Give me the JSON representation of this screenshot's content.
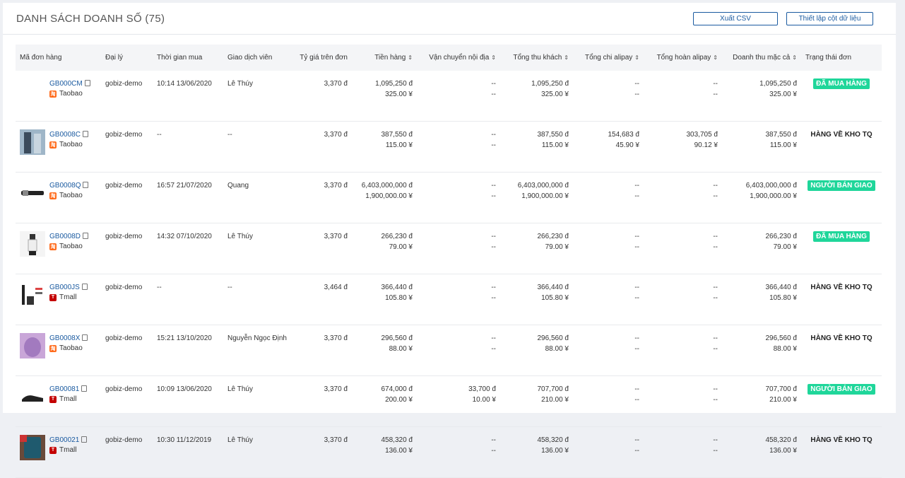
{
  "header": {
    "title": "DANH SÁCH DOANH SỐ (75)",
    "export_csv": "Xuất CSV",
    "column_settings": "Thiết lập cột dữ liệu"
  },
  "columns": [
    {
      "label": "Mã đơn hàng",
      "sortable": false
    },
    {
      "label": "Đại lý",
      "sortable": false
    },
    {
      "label": "Thời gian mua",
      "sortable": false
    },
    {
      "label": "Giao dịch viên",
      "sortable": false
    },
    {
      "label": "Tỷ giá trên đơn",
      "sortable": false
    },
    {
      "label": "Tiền hàng",
      "sortable": true
    },
    {
      "label": "Vận chuyển nội địa",
      "sortable": true
    },
    {
      "label": "Tổng thu khách",
      "sortable": true
    },
    {
      "label": "Tổng chi alipay",
      "sortable": true
    },
    {
      "label": "Tổng hoàn alipay",
      "sortable": true
    },
    {
      "label": "Doanh thu mặc cả",
      "sortable": true
    },
    {
      "label": "Trạng thái đơn",
      "sortable": false
    }
  ],
  "status_colors": {
    "badge": "#1fd69a",
    "link": "#1a5aa0"
  },
  "rows": [
    {
      "code": "GB000CM",
      "platform": "Taobao",
      "thumb": "none",
      "agency": "gobiz-demo",
      "time": "10:14 13/06/2020",
      "staff": "Lê Thúy",
      "rate": "3,370 đ",
      "goods_vnd": "1,095,250 đ",
      "goods_cny": "325.00 ¥",
      "ship_vnd": "--",
      "ship_cny": "--",
      "total_vnd": "1,095,250 đ",
      "total_cny": "325.00 ¥",
      "alipay_out": "--",
      "alipay_out2": "--",
      "alipay_ref": "--",
      "alipay_ref2": "--",
      "rev_vnd": "1,095,250 đ",
      "rev_cny": "325.00 ¥",
      "status": "ĐÃ MUA HÀNG",
      "status_badge": true
    },
    {
      "code": "GB0008C",
      "platform": "Taobao",
      "thumb": "clothes-photo",
      "agency": "gobiz-demo",
      "time": "--",
      "staff": "--",
      "rate": "3,370 đ",
      "goods_vnd": "387,550 đ",
      "goods_cny": "115.00 ¥",
      "ship_vnd": "--",
      "ship_cny": "--",
      "total_vnd": "387,550 đ",
      "total_cny": "115.00 ¥",
      "alipay_out": "154,683 đ",
      "alipay_out2": "45.90 ¥",
      "alipay_ref": "303,705 đ",
      "alipay_ref2": "90.12 ¥",
      "rev_vnd": "387,550 đ",
      "rev_cny": "115.00 ¥",
      "status": "HÀNG VỀ KHO TQ",
      "status_badge": false
    },
    {
      "code": "GB0008Q",
      "platform": "Taobao",
      "thumb": "belt-photo",
      "agency": "gobiz-demo",
      "time": "16:57 21/07/2020",
      "staff": "Quang",
      "rate": "3,370 đ",
      "goods_vnd": "6,403,000,000 đ",
      "goods_cny": "1,900,000.00 ¥",
      "ship_vnd": "--",
      "ship_cny": "--",
      "total_vnd": "6,403,000,000 đ",
      "total_cny": "1,900,000.00 ¥",
      "alipay_out": "--",
      "alipay_out2": "--",
      "alipay_ref": "--",
      "alipay_ref2": "--",
      "rev_vnd": "6,403,000,000 đ",
      "rev_cny": "1,900,000.00 ¥",
      "status": "NGƯỜI BÁN GIAO",
      "status_badge": true
    },
    {
      "code": "GB0008D",
      "platform": "Taobao",
      "thumb": "outfit-photo",
      "agency": "gobiz-demo",
      "time": "14:32 07/10/2020",
      "staff": "Lê Thúy",
      "rate": "3,370 đ",
      "goods_vnd": "266,230 đ",
      "goods_cny": "79.00 ¥",
      "ship_vnd": "--",
      "ship_cny": "--",
      "total_vnd": "266,230 đ",
      "total_cny": "79.00 ¥",
      "alipay_out": "--",
      "alipay_out2": "--",
      "alipay_ref": "--",
      "alipay_ref2": "--",
      "rev_vnd": "266,230 đ",
      "rev_cny": "79.00 ¥",
      "status": "ĐÃ MUA HÀNG",
      "status_badge": true
    },
    {
      "code": "GB000JS",
      "platform": "Tmall",
      "thumb": "product-photo",
      "agency": "gobiz-demo",
      "time": "--",
      "staff": "--",
      "rate": "3,464 đ",
      "goods_vnd": "366,440 đ",
      "goods_cny": "105.80 ¥",
      "ship_vnd": "--",
      "ship_cny": "--",
      "total_vnd": "366,440 đ",
      "total_cny": "105.80 ¥",
      "alipay_out": "--",
      "alipay_out2": "--",
      "alipay_ref": "--",
      "alipay_ref2": "--",
      "rev_vnd": "366,440 đ",
      "rev_cny": "105.80 ¥",
      "status": "HÀNG VỀ KHO TQ",
      "status_badge": false
    },
    {
      "code": "GB0008X",
      "platform": "Taobao",
      "thumb": "purple-photo",
      "agency": "gobiz-demo",
      "time": "15:21 13/10/2020",
      "staff": "Nguyễn Ngọc Định",
      "rate": "3,370 đ",
      "goods_vnd": "296,560 đ",
      "goods_cny": "88.00 ¥",
      "ship_vnd": "--",
      "ship_cny": "--",
      "total_vnd": "296,560 đ",
      "total_cny": "88.00 ¥",
      "alipay_out": "--",
      "alipay_out2": "--",
      "alipay_ref": "--",
      "alipay_ref2": "--",
      "rev_vnd": "296,560 đ",
      "rev_cny": "88.00 ¥",
      "status": "HÀNG VỀ KHO TQ",
      "status_badge": false
    },
    {
      "code": "GB00081",
      "platform": "Tmall",
      "thumb": "shoe-photo",
      "agency": "gobiz-demo",
      "time": "10:09 13/06/2020",
      "staff": "Lê Thúy",
      "rate": "3,370 đ",
      "goods_vnd": "674,000 đ",
      "goods_cny": "200.00 ¥",
      "ship_vnd": "33,700 đ",
      "ship_cny": "10.00 ¥",
      "total_vnd": "707,700 đ",
      "total_cny": "210.00 ¥",
      "alipay_out": "--",
      "alipay_out2": "--",
      "alipay_ref": "--",
      "alipay_ref2": "--",
      "rev_vnd": "707,700 đ",
      "rev_cny": "210.00 ¥",
      "status": "NGƯỜI BÁN GIAO",
      "status_badge": true
    },
    {
      "code": "GB00021",
      "platform": "Tmall",
      "thumb": "phone-photo",
      "agency": "gobiz-demo",
      "time": "10:30 11/12/2019",
      "staff": "Lê Thúy",
      "rate": "3,370 đ",
      "goods_vnd": "458,320 đ",
      "goods_cny": "136.00 ¥",
      "ship_vnd": "--",
      "ship_cny": "--",
      "total_vnd": "458,320 đ",
      "total_cny": "136.00 ¥",
      "alipay_out": "--",
      "alipay_out2": "--",
      "alipay_ref": "--",
      "alipay_ref2": "--",
      "rev_vnd": "458,320 đ",
      "rev_cny": "136.00 ¥",
      "status": "HÀNG VỀ KHO TQ",
      "status_badge": false
    }
  ]
}
